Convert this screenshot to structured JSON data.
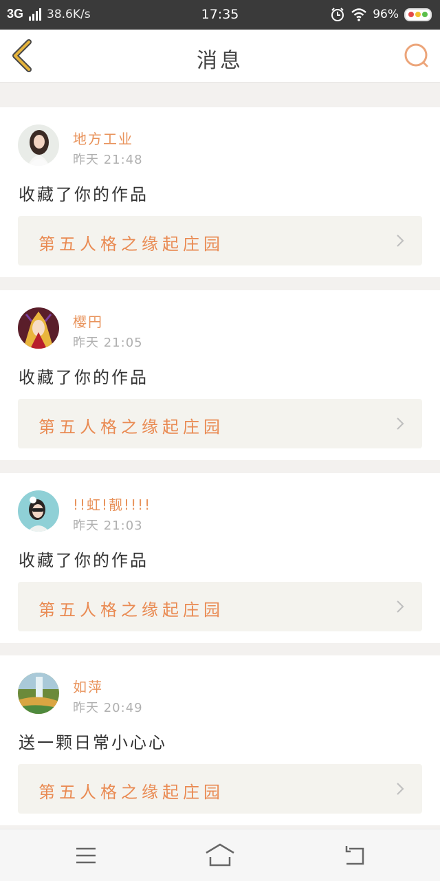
{
  "status_bar": {
    "network": "3G",
    "speed": "38.6K/s",
    "time": "17:35",
    "battery": "96%",
    "icons": [
      "signal-icon",
      "alarm-icon",
      "wifi-icon",
      "battery-icon"
    ]
  },
  "header": {
    "title": "消息",
    "back_icon": "chevron-left-icon",
    "search_icon": "search-icon"
  },
  "colors": {
    "accent": "#e8925a",
    "back_arrow": "#e6b43c",
    "card_bg": "#ffffff",
    "link_bg": "#f4f3ee",
    "page_bg": "#f3f1ef"
  },
  "messages": [
    {
      "username": "地方工业",
      "time": "昨天 21:48",
      "action": "收藏了你的作品",
      "work_title": "第五人格之缘起庄园",
      "avatar": "avatar-woman-white-top"
    },
    {
      "username": "樱円",
      "time": "昨天 21:05",
      "action": "收藏了你的作品",
      "work_title": "第五人格之缘起庄园",
      "avatar": "avatar-anime-blonde"
    },
    {
      "username": "!!虹!靓!!!!",
      "time": "昨天 21:03",
      "action": "收藏了你的作品",
      "work_title": "第五人格之缘起庄园",
      "avatar": "avatar-woman-sunglasses"
    },
    {
      "username": "如萍",
      "time": "昨天 20:49",
      "action": "送一颗日常小心心",
      "work_title": "第五人格之缘起庄园",
      "avatar": "avatar-waterfall-landscape"
    }
  ],
  "bottom_nav": [
    "menu-icon",
    "home-icon",
    "back-icon"
  ]
}
